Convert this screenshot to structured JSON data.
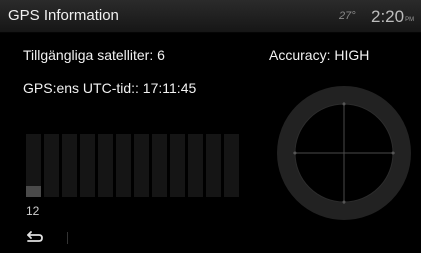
{
  "header": {
    "title": "GPS Information",
    "temperature": "27°",
    "time": "2:20",
    "time_suffix": "PM"
  },
  "info": {
    "satellites": "Tillgängliga satelliter: 6",
    "accuracy": "Accuracy: HIGH",
    "utc_time": "GPS:ens UTC-tid:: 17:11:45"
  },
  "signal_bars": {
    "count": 12,
    "levels": [
      0.17,
      0,
      0,
      0,
      0,
      0,
      0,
      0,
      0,
      0,
      0,
      0
    ],
    "label": "12"
  },
  "footer": {
    "back_icon": "back-arrow-icon"
  },
  "compass": {
    "icon": "compass-crosshair-icon"
  },
  "colors": {
    "background": "#000000",
    "header": "#1f1f1f",
    "text": "#f2f2f2",
    "bar_empty": "#151515",
    "bar_fill": "#4a4a4a",
    "compass_ring": "#262626"
  }
}
